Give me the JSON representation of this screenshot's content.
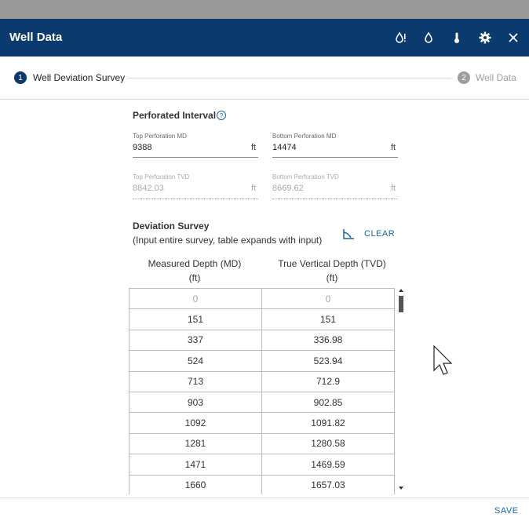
{
  "window": {
    "title": "Well Data",
    "accent": "#0a3a6e",
    "icons": [
      "water-alert-icon",
      "water-drop-icon",
      "thermometer-icon",
      "gear-icon",
      "close-icon"
    ]
  },
  "stepper": {
    "steps": [
      {
        "number": "1",
        "label": "Well Deviation Survey",
        "state": "active"
      },
      {
        "number": "2",
        "label": "Well Data",
        "state": "inactive"
      }
    ]
  },
  "perforated": {
    "title": "Perforated Interval",
    "top_md": {
      "label": "Top Perforation MD",
      "value": "9388",
      "unit": "ft"
    },
    "bottom_md": {
      "label": "Bottom Perforation MD",
      "value": "14474",
      "unit": "ft"
    },
    "top_tvd": {
      "label": "Top Perforation TVD",
      "value": "8842.03",
      "unit": "ft"
    },
    "bottom_tvd": {
      "label": "Bottom Perforation TVD",
      "value": "8669.62",
      "unit": "ft"
    }
  },
  "survey": {
    "title": "Deviation Survey",
    "subtitle": "(Input entire survey, table expands with input)",
    "clear_label": "CLEAR",
    "columns": [
      {
        "line1": "Measured Depth (MD)",
        "line2": "(ft)"
      },
      {
        "line1": "True Vertical Depth (TVD)",
        "line2": "(ft)"
      }
    ],
    "rows": [
      [
        "0",
        "0"
      ],
      [
        "151",
        "151"
      ],
      [
        "337",
        "336.98"
      ],
      [
        "524",
        "523.94"
      ],
      [
        "713",
        "712.9"
      ],
      [
        "903",
        "902.85"
      ],
      [
        "1092",
        "1091.82"
      ],
      [
        "1281",
        "1280.58"
      ],
      [
        "1471",
        "1469.59"
      ],
      [
        "1660",
        "1657.03"
      ]
    ]
  },
  "footer": {
    "save_label": "SAVE"
  }
}
